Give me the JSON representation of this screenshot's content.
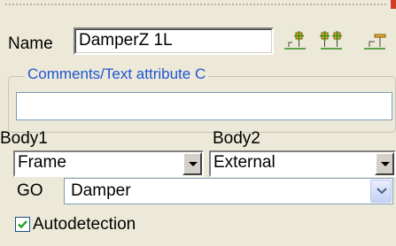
{
  "name": {
    "label": "Name",
    "value": "DamperZ 1L"
  },
  "toolbar": {
    "icons": [
      "add-node-icon",
      "add-multiple-nodes-icon",
      "node-options-icon"
    ],
    "accent_color": "#2f8a1a"
  },
  "comments": {
    "label": "Comments/Text attribute C",
    "value": ""
  },
  "body1": {
    "label": "Body1",
    "value": "Frame"
  },
  "body2": {
    "label": "Body2",
    "value": "External"
  },
  "go": {
    "label": "GO",
    "value": "Damper"
  },
  "autodetection": {
    "label": "Autodetection",
    "checked": true
  },
  "colors": {
    "legend_text": "#1f54d6",
    "panel_bg": "#ece9d8"
  }
}
